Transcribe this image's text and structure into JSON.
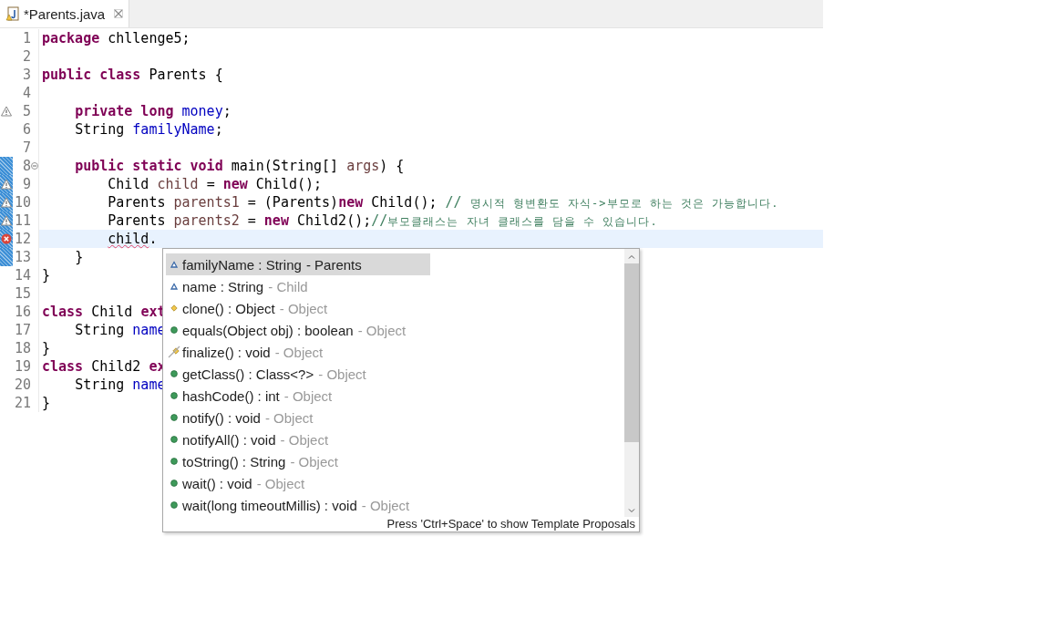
{
  "tab": {
    "title": "*Parents.java",
    "selected": true,
    "warning": true
  },
  "editor": {
    "lines": [
      {
        "number": "1",
        "warning": false,
        "error": false,
        "changed": false,
        "current": false,
        "tokens": [
          {
            "kind": "keyword",
            "text": "package"
          },
          {
            "kind": "plain",
            "text": " chllenge5;"
          }
        ]
      },
      {
        "number": "2",
        "warning": false,
        "error": false,
        "changed": false,
        "current": false
      },
      {
        "number": "3",
        "warning": false,
        "error": false,
        "changed": false,
        "current": false,
        "tokens": [
          {
            "kind": "keyword",
            "text": "public class"
          },
          {
            "kind": "plain",
            "text": " Parents {"
          }
        ]
      },
      {
        "number": "4",
        "warning": false,
        "error": false,
        "changed": false,
        "current": false
      },
      {
        "number": "5",
        "warning": true,
        "error": false,
        "changed": false,
        "current": false,
        "tokens": [
          {
            "kind": "keyword",
            "text": "    private long"
          },
          {
            "kind": "field",
            "text": " money"
          },
          {
            "kind": "plain",
            "text": ";"
          }
        ]
      },
      {
        "number": "6",
        "warning": false,
        "error": false,
        "changed": false,
        "current": false,
        "tokens": [
          {
            "kind": "plain",
            "text": "    String "
          },
          {
            "kind": "field",
            "text": "familyName"
          },
          {
            "kind": "plain",
            "text": ";"
          }
        ]
      },
      {
        "number": "7",
        "warning": false,
        "error": false,
        "changed": false,
        "current": false
      },
      {
        "number": "8",
        "warning": false,
        "error": false,
        "changed": true,
        "current": false,
        "expanded": true,
        "tokens": [
          {
            "kind": "keyword",
            "text": "    public static void"
          },
          {
            "kind": "plain",
            "text": " main(String[] "
          },
          {
            "kind": "local",
            "text": "args"
          },
          {
            "kind": "plain",
            "text": ") {"
          }
        ]
      },
      {
        "number": "9",
        "warning": true,
        "error": false,
        "changed": true,
        "current": false,
        "tokens": [
          {
            "kind": "plain",
            "text": "        Child "
          },
          {
            "kind": "local",
            "text": "child"
          },
          {
            "kind": "plain",
            "text": " = "
          },
          {
            "kind": "keyword",
            "text": "new"
          },
          {
            "kind": "plain",
            "text": " Child();"
          }
        ]
      },
      {
        "number": "10",
        "warning": true,
        "error": false,
        "changed": true,
        "current": false,
        "tokens": [
          {
            "kind": "plain",
            "text": "        Parents "
          },
          {
            "kind": "local",
            "text": "parents1"
          },
          {
            "kind": "plain",
            "text": " = (Parents)"
          },
          {
            "kind": "keyword",
            "text": "new"
          },
          {
            "kind": "plain",
            "text": " Child(); "
          },
          {
            "kind": "comment",
            "text": "// "
          },
          {
            "kind": "comment-small",
            "text": "명시적 형변환도 자식->부모로 하는 것은 가능합니다."
          }
        ]
      },
      {
        "number": "11",
        "warning": true,
        "error": false,
        "changed": true,
        "current": false,
        "tokens": [
          {
            "kind": "plain",
            "text": "        Parents "
          },
          {
            "kind": "local",
            "text": "parents2"
          },
          {
            "kind": "plain",
            "text": " = "
          },
          {
            "kind": "keyword",
            "text": "new"
          },
          {
            "kind": "plain",
            "text": " Child2();"
          },
          {
            "kind": "comment",
            "text": "//"
          },
          {
            "kind": "comment-small",
            "text": "부모클래스는 자녀 클래스를 담을 수 있습니다."
          }
        ]
      },
      {
        "number": "12",
        "warning": false,
        "error": true,
        "changed": true,
        "current": true,
        "tokens": [
          {
            "kind": "error",
            "text": "        child"
          },
          {
            "kind": "plain",
            "text": "."
          }
        ]
      },
      {
        "number": "13",
        "warning": false,
        "error": false,
        "changed": true,
        "current": false,
        "tokens": [
          {
            "kind": "plain",
            "text": "    }"
          }
        ]
      },
      {
        "number": "14",
        "warning": false,
        "error": false,
        "changed": false,
        "current": false,
        "tokens": [
          {
            "kind": "plain",
            "text": "}"
          }
        ]
      },
      {
        "number": "15",
        "warning": false,
        "error": false,
        "changed": false,
        "current": false
      },
      {
        "number": "16",
        "warning": false,
        "error": false,
        "changed": false,
        "current": false,
        "tokens": [
          {
            "kind": "keyword",
            "text": "class"
          },
          {
            "kind": "plain",
            "text": " Child "
          },
          {
            "kind": "keyword",
            "text": "ext"
          }
        ]
      },
      {
        "number": "17",
        "warning": false,
        "error": false,
        "changed": false,
        "current": false,
        "tokens": [
          {
            "kind": "plain",
            "text": "    String "
          },
          {
            "kind": "field",
            "text": "name"
          }
        ]
      },
      {
        "number": "18",
        "warning": false,
        "error": false,
        "changed": false,
        "current": false,
        "tokens": [
          {
            "kind": "plain",
            "text": "}"
          }
        ]
      },
      {
        "number": "19",
        "warning": false,
        "error": false,
        "changed": false,
        "current": false,
        "tokens": [
          {
            "kind": "keyword",
            "text": "class"
          },
          {
            "kind": "plain",
            "text": " Child2 "
          },
          {
            "kind": "keyword",
            "text": "ex"
          }
        ]
      },
      {
        "number": "20",
        "warning": false,
        "error": false,
        "changed": false,
        "current": false,
        "tokens": [
          {
            "kind": "plain",
            "text": "    String "
          },
          {
            "kind": "field",
            "text": "name"
          }
        ]
      },
      {
        "number": "21",
        "warning": false,
        "error": false,
        "changed": false,
        "current": false,
        "tokens": [
          {
            "kind": "plain",
            "text": "}"
          }
        ]
      }
    ]
  },
  "completion": {
    "items": [
      {
        "kind": "field",
        "signature": "familyName : String",
        "owner": "- Parents",
        "selected": true
      },
      {
        "kind": "field",
        "signature": "name : String",
        "owner": "- Child",
        "selected": false
      },
      {
        "kind": "protected",
        "signature": "clone() : Object",
        "owner": "- Object",
        "selected": false
      },
      {
        "kind": "public",
        "signature": "equals(Object obj) : boolean",
        "owner": "- Object",
        "selected": false
      },
      {
        "kind": "deprecated",
        "signature": "finalize() : void",
        "owner": "- Object",
        "selected": false
      },
      {
        "kind": "public",
        "signature": "getClass() : Class<?>",
        "owner": "- Object",
        "selected": false
      },
      {
        "kind": "public",
        "signature": "hashCode() : int",
        "owner": "- Object",
        "selected": false
      },
      {
        "kind": "public",
        "signature": "notify() : void",
        "owner": "- Object",
        "selected": false
      },
      {
        "kind": "public",
        "signature": "notifyAll() : void",
        "owner": "- Object",
        "selected": false
      },
      {
        "kind": "public",
        "signature": "toString() : String",
        "owner": "- Object",
        "selected": false
      },
      {
        "kind": "public",
        "signature": "wait() : void",
        "owner": "- Object",
        "selected": false
      },
      {
        "kind": "public",
        "signature": "wait(long timeoutMillis) : void",
        "owner": "- Object",
        "selected": false
      }
    ],
    "footer": "Press 'Ctrl+Space' to show Template Proposals"
  }
}
